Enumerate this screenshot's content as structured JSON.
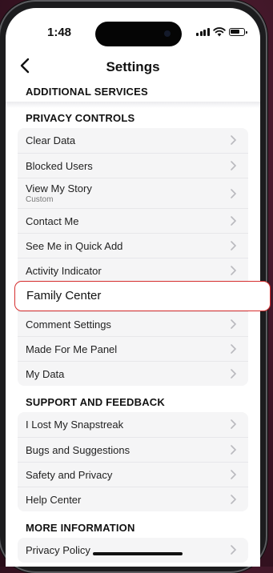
{
  "status_bar": {
    "time": "1:48"
  },
  "nav": {
    "back_glyph": "<",
    "title": "Settings"
  },
  "sections": [
    {
      "header": "ADDITIONAL SERVICES",
      "items": []
    },
    {
      "header": "PRIVACY CONTROLS",
      "items": [
        {
          "label": "Clear Data"
        },
        {
          "label": "Blocked Users"
        },
        {
          "label": "View My Story",
          "sublabel": "Custom"
        },
        {
          "label": "Contact Me"
        },
        {
          "label": "See Me in Quick Add"
        },
        {
          "label": "Activity Indicator"
        },
        {
          "label": "Family Center",
          "highlighted": true
        },
        {
          "label": "Comment Settings"
        },
        {
          "label": "Made For Me Panel"
        },
        {
          "label": "My Data"
        }
      ]
    },
    {
      "header": "SUPPORT AND FEEDBACK",
      "items": [
        {
          "label": "I Lost My Snapstreak"
        },
        {
          "label": "Bugs and Suggestions"
        },
        {
          "label": "Safety and Privacy"
        },
        {
          "label": "Help Center"
        }
      ]
    },
    {
      "header": "MORE INFORMATION",
      "items": [
        {
          "label": "Privacy Policy"
        }
      ]
    }
  ],
  "icons": {
    "chevron": "chevron-right-icon",
    "back": "chevron-left-icon"
  },
  "colors": {
    "highlight_border": "#d62f2f",
    "background": "#3a1424"
  }
}
